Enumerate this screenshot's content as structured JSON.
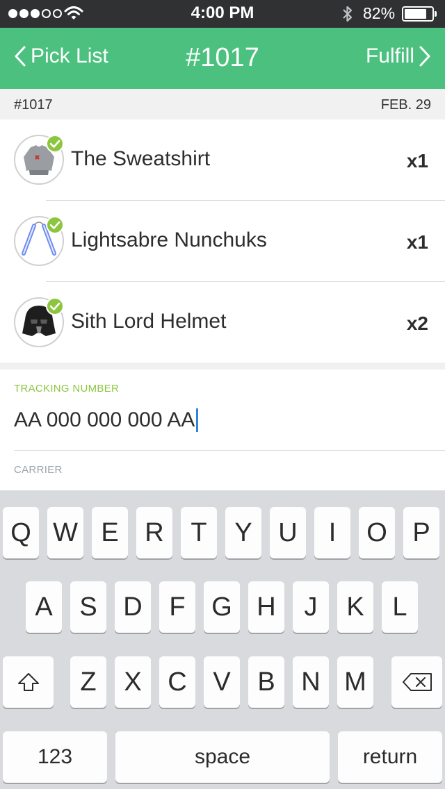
{
  "status_bar": {
    "time": "4:00 PM",
    "battery_percent": "82%",
    "battery_level": 0.82,
    "signal_bars_filled": 3,
    "signal_bars_total": 5
  },
  "nav": {
    "back_label": "Pick List",
    "title": "#1017",
    "action_label": "Fulfill",
    "color": "#4cc17f"
  },
  "order": {
    "number": "#1017",
    "date": "FEB. 29"
  },
  "items": [
    {
      "name": "The Sweatshirt",
      "qty": "x1",
      "icon": "sweatshirt-icon"
    },
    {
      "name": "Lightsabre Nunchuks",
      "qty": "x1",
      "icon": "nunchuks-icon"
    },
    {
      "name": "Sith Lord Helmet",
      "qty": "x2",
      "icon": "helmet-icon"
    }
  ],
  "form": {
    "tracking_label": "TRACKING NUMBER",
    "tracking_value": "AA 000 000 000 AA",
    "carrier_label": "CARRIER",
    "accent": "#8cc63f"
  },
  "keyboard": {
    "row1": [
      "Q",
      "W",
      "E",
      "R",
      "T",
      "Y",
      "U",
      "I",
      "O",
      "P"
    ],
    "row2": [
      "A",
      "S",
      "D",
      "F",
      "G",
      "H",
      "J",
      "K",
      "L"
    ],
    "row3": [
      "Z",
      "X",
      "C",
      "V",
      "B",
      "N",
      "M"
    ],
    "numbers_key": "123",
    "space_key": "space",
    "return_key": "return"
  }
}
